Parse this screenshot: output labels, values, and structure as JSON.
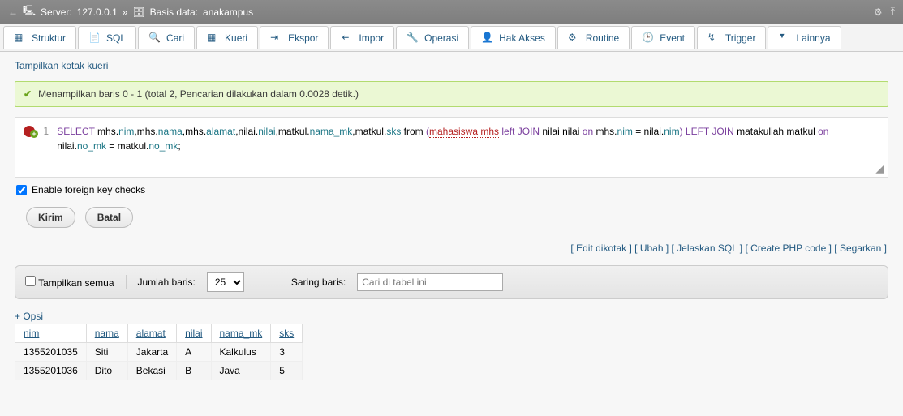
{
  "breadcrumb": {
    "server_label": "Server:",
    "server": "127.0.0.1",
    "db_label": "Basis data:",
    "db": "anakampus"
  },
  "tabs": {
    "struktur": "Struktur",
    "sql": "SQL",
    "cari": "Cari",
    "kueri": "Kueri",
    "ekspor": "Ekspor",
    "impor": "Impor",
    "operasi": "Operasi",
    "hak": "Hak Akses",
    "routine": "Routine",
    "event": "Event",
    "trigger": "Trigger",
    "lainnya": "Lainnya"
  },
  "show_query": "Tampilkan kotak kueri",
  "success": "Menampilkan baris 0 - 1 (total 2, Pencarian dilakukan dalam 0.0028 detik.)",
  "sql": {
    "lineno": "1",
    "t1": "SELECT",
    "t2": " mhs",
    "t3": ".",
    "t4": "nim",
    "t5": ",mhs",
    "t6": ".",
    "t7": "nama",
    "t8": ",mhs",
    "t9": ".",
    "t10": "alamat",
    "t11": ",nilai",
    "t12": ".",
    "t13": "nilai",
    "t14": ",matkul",
    "t15": ".",
    "t16": "nama_mk",
    "t17": ",matkul",
    "t18": ".",
    "t19": "sks",
    "t20": " from ",
    "t21": "(",
    "t22": "mahasiswa",
    "t23": " ",
    "t24": "mhs",
    "t25": " ",
    "t26": "left",
    "t27": " ",
    "t28": "JOIN",
    "t29": " nilai nilai ",
    "t30": "on",
    "t31": " mhs",
    "t32": ".",
    "t33": "nim",
    "t34": " = nilai",
    "t35": ".",
    "t36": "nim",
    "t37": ")",
    "t38": " ",
    "t39": "LEFT",
    "t40": " ",
    "t41": "JOIN",
    "t42": " matakuliah matkul ",
    "t43": "on",
    "t44": " nilai",
    "t45": ".",
    "t46": "no_mk",
    "t47": " = matkul",
    "t48": ".",
    "t49": "no_mk",
    "t50": ";"
  },
  "fk_label": "Enable foreign key checks",
  "btn_submit": "Kirim",
  "btn_cancel": "Batal",
  "links": {
    "edit": "Edit dikotak",
    "ubah": "Ubah",
    "jelaskan": "Jelaskan SQL",
    "php": "Create PHP code",
    "segarkan": "Segarkan"
  },
  "filter": {
    "showall": "Tampilkan semua",
    "rows_label": "Jumlah baris:",
    "rows_value": "25",
    "search_label": "Saring baris:",
    "search_ph": "Cari di tabel ini"
  },
  "opsi": "+ Opsi",
  "headers": {
    "nim": "nim",
    "nama": "nama",
    "alamat": "alamat",
    "nilai": "nilai",
    "nama_mk": "nama_mk",
    "sks": "sks"
  },
  "rows": [
    {
      "nim": "1355201035",
      "nama": "Siti",
      "alamat": "Jakarta",
      "nilai": "A",
      "nama_mk": "Kalkulus",
      "sks": "3"
    },
    {
      "nim": "1355201036",
      "nama": "Dito",
      "alamat": "Bekasi",
      "nilai": "B",
      "nama_mk": "Java",
      "sks": "5"
    }
  ]
}
